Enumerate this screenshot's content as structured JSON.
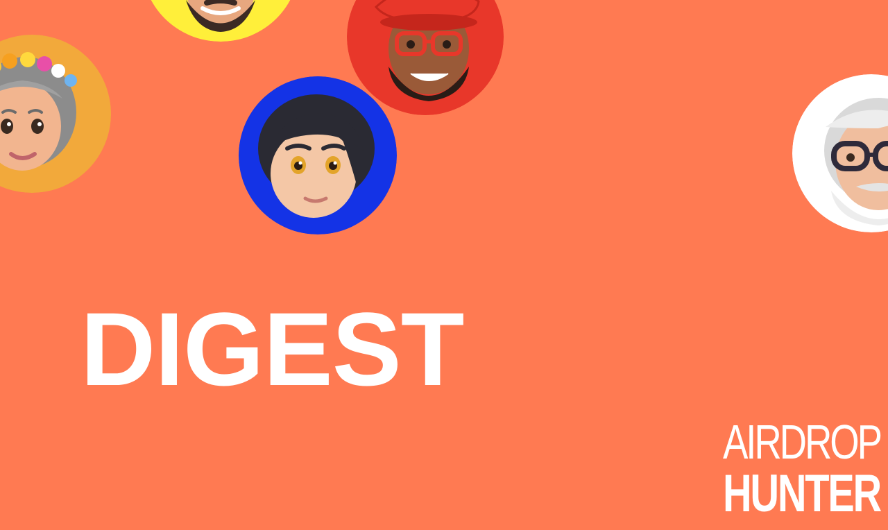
{
  "page": {
    "background_color": "#FF7A52"
  },
  "headline": {
    "text": "DIGEST"
  },
  "brand": {
    "line1": "AIRDROP",
    "line2": "HUNTER"
  },
  "avatars": [
    {
      "name": "avatar-bearded-man",
      "background": "#FFEF3A"
    },
    {
      "name": "avatar-grandma-flower-crown",
      "background": "#F2A93B"
    },
    {
      "name": "avatar-boy-dark-hair",
      "background": "#1433E6"
    },
    {
      "name": "avatar-man-red-beret-glasses",
      "background": "#E8372A"
    },
    {
      "name": "avatar-old-man-glasses",
      "background": "#FFFFFF"
    }
  ]
}
